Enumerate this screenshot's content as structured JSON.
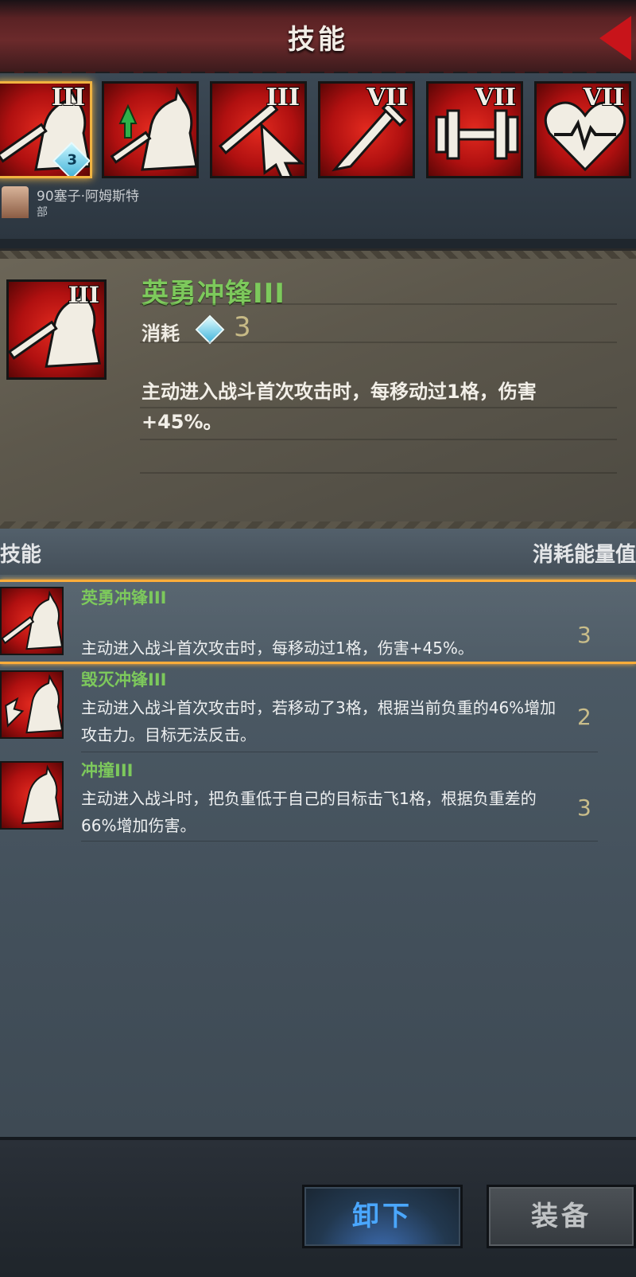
{
  "header": {
    "title": "技能",
    "back_icon": "back-arrow-icon"
  },
  "skill_strip": {
    "slots": [
      {
        "icon": "sword-horse-icon",
        "rank": "III",
        "cost": "3",
        "selected": true
      },
      {
        "icon": "upgrade-horse-icon",
        "rank": "",
        "selected": false
      },
      {
        "icon": "sword-cursor-icon",
        "rank": "III",
        "selected": false
      },
      {
        "icon": "sword-icon",
        "rank": "VII",
        "selected": false
      },
      {
        "icon": "dumbbell-icon",
        "rank": "VII",
        "selected": false
      },
      {
        "icon": "heart-pulse-icon",
        "rank": "VII",
        "selected": false
      }
    ],
    "hero_name": "90塞子·阿姆斯特",
    "hero_sub": "部"
  },
  "detail": {
    "name": "英勇冲锋III",
    "rank": "III",
    "cost_label": "消耗",
    "cost_value": "3",
    "description": "主动进入战斗首次攻击时，每移动过1格，伤害+45%。"
  },
  "list": {
    "header_skill": "技能",
    "header_cost": "消耗能量值",
    "items": [
      {
        "name": "英勇冲锋III",
        "desc": "主动进入战斗首次攻击时，每移动过1格，伤害+45%。",
        "cost": "3",
        "selected": true
      },
      {
        "name": "毁灭冲锋III",
        "desc": "主动进入战斗首次攻击时，若移动了3格，根据当前负重的46%增加攻击力。目标无法反击。",
        "cost": "2",
        "selected": false
      },
      {
        "name": "冲撞III",
        "desc": "主动进入战斗时，把负重低于自己的目标击飞1格，根据负重差的66%增加伤害。",
        "cost": "3",
        "selected": false
      }
    ]
  },
  "footer": {
    "unequip_label": "卸下",
    "equip_label": "装备"
  },
  "colors": {
    "accent_green": "#7dc95c",
    "skill_red": "#c8141a",
    "select_orange": "#ffad3a",
    "unequip_blue": "#4aa7ff"
  }
}
